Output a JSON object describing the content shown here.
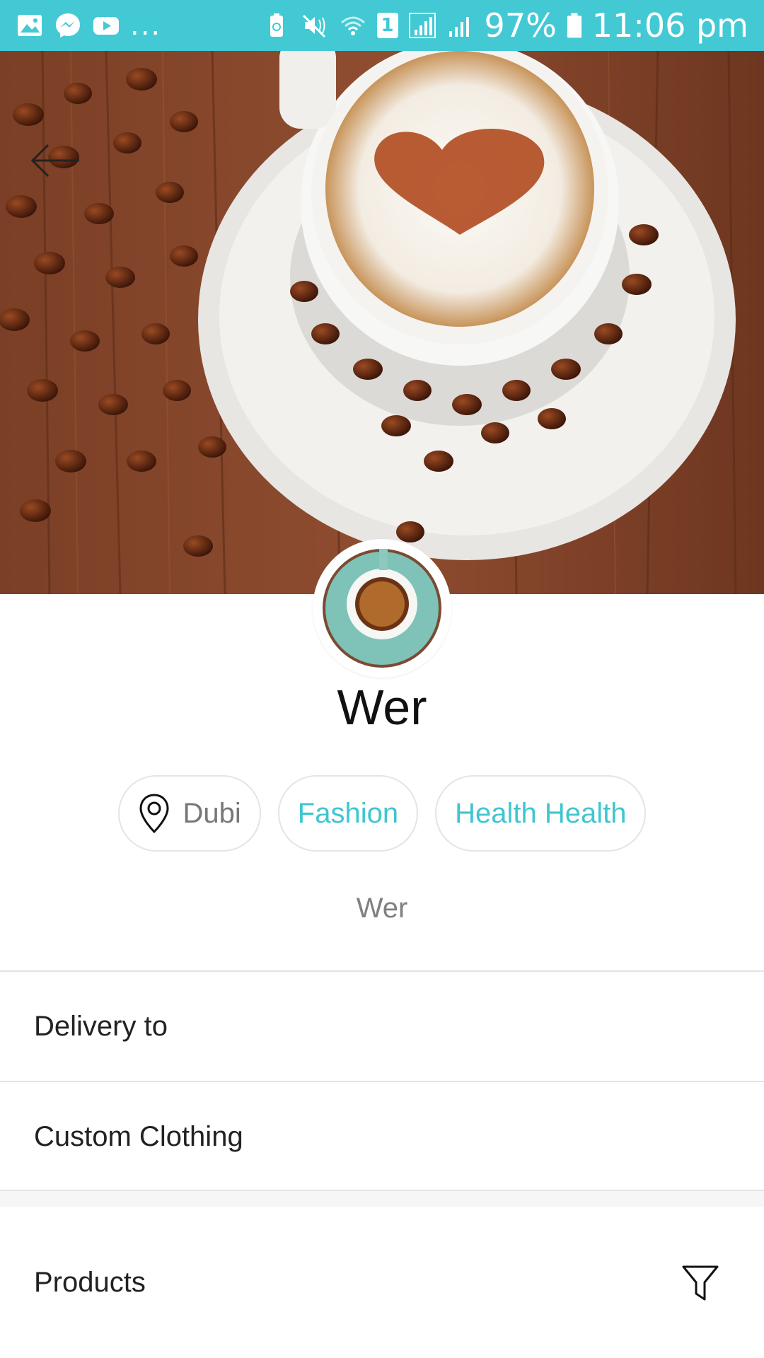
{
  "status_bar": {
    "battery": "97%",
    "time": "11:06 pm",
    "sim_slot": "1",
    "more": "...",
    "background_color": "#42c9d4"
  },
  "icons": {
    "gallery": "gallery-icon",
    "messenger": "messenger-icon",
    "youtube": "youtube-icon",
    "back": "back-arrow-icon",
    "location": "location-pin-icon",
    "filter": "filter-icon"
  },
  "profile": {
    "name": "Wer",
    "location": "Dubi",
    "tags": [
      "Fashion",
      "Health Health"
    ],
    "description": "Wer"
  },
  "sections": {
    "delivery_label": "Delivery to",
    "category_label": "Custom Clothing",
    "products_label": "Products"
  },
  "colors": {
    "accent": "#3fc6d0",
    "divider": "#e3e3e3"
  }
}
